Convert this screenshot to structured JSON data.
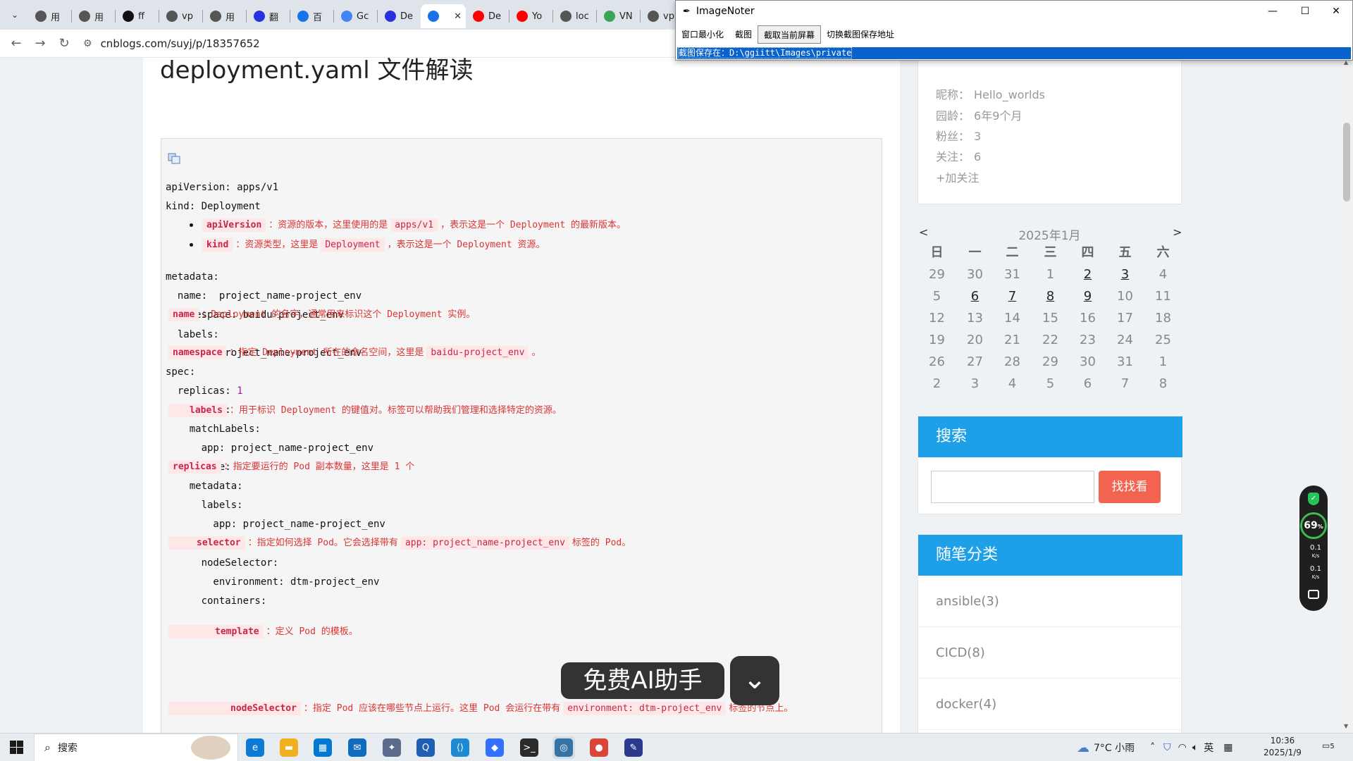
{
  "browser": {
    "tabs": [
      {
        "label": "用",
        "icon": "globe",
        "color": "#555"
      },
      {
        "label": "用",
        "icon": "globe",
        "color": "#555"
      },
      {
        "label": "ff",
        "icon": "github",
        "color": "#111"
      },
      {
        "label": "vp",
        "icon": "globe",
        "color": "#555"
      },
      {
        "label": "用",
        "icon": "globe",
        "color": "#555"
      },
      {
        "label": "翻",
        "icon": "baidu-paw",
        "color": "#2932e1"
      },
      {
        "label": "百",
        "icon": "translate",
        "color": "#1a73e8"
      },
      {
        "label": "Gc",
        "icon": "google-g",
        "color": "#4285f4"
      },
      {
        "label": "De",
        "icon": "baidu-paw",
        "color": "#2932e1"
      },
      {
        "label": "",
        "icon": "cnblogs",
        "color": "#1a73e8",
        "active": true
      },
      {
        "label": "De",
        "icon": "youtube",
        "color": "#ff0000"
      },
      {
        "label": "Yo",
        "icon": "youtube",
        "color": "#ff0000"
      },
      {
        "label": "loc",
        "icon": "globe",
        "color": "#555"
      },
      {
        "label": "VN",
        "icon": "vmware",
        "color": "#3aa655"
      },
      {
        "label": "vp",
        "icon": "globe",
        "color": "#555"
      }
    ],
    "active_tab_close": "✕",
    "url": "cnblogs.com/suyj/p/18357652"
  },
  "article": {
    "title": "deployment.yaml 文件解读",
    "code_lines": [
      "apiVersion: apps/v1",
      "kind: Deployment",
      "metadata:",
      "  name:  project_name-project_env",
      "  namespace: baidu-project_env",
      "  labels:",
      "    app: project_name-project_env",
      "spec:",
      "  replicas: 1",
      "  selector:",
      "    matchLabels:",
      "      app: project_name-project_env",
      "  template:",
      "    metadata:",
      "      labels:",
      "        app: project_name-project_env",
      "    spec:",
      "      nodeSelector:",
      "        environment: dtm-project_env",
      "      containers:"
    ],
    "notes": {
      "apiVersion": {
        "kw": "apiVersion",
        "t1": "：资源的版本，这里使用的是",
        "lit": "apps/v1",
        "t2": "，表示这是一个 Deployment 的最新版本。"
      },
      "kind": {
        "kw": "kind",
        "t1": "：资源类型，这里是",
        "lit": "Deployment",
        "t2": "，表示这是一个 Deployment 资源。"
      },
      "name": {
        "kw": "name",
        "t1": "：Deployment 的名字，通常用来标识这个 Deployment 实例。"
      },
      "namespace": {
        "kw": "namespace",
        "t1": "：指定 Deployment 所在的命名空间，这里是",
        "lit": "baidu-project_env",
        "t2": "。"
      },
      "labels": {
        "kw": "labels",
        "t1": "：用于标识 Deployment 的键值对。标签可以帮助我们管理和选择特定的资源。"
      },
      "replicas": {
        "kw": "replicas",
        "t1": "：指定要运行的 Pod 副本数量，这里是 1 个"
      },
      "selector": {
        "kw": "selector",
        "t1": "：指定如何选择 Pod。它会选择带有",
        "lit": "app: project_name-project_env",
        "t2": "标签的 Pod。"
      },
      "template": {
        "kw": "template",
        "t1": "：定义 Pod 的模板。"
      },
      "nodeSelector": {
        "kw": "nodeSelector",
        "t1": "：指定 Pod 应该在哪些节点上运行。这里 Pod 会运行在带有",
        "lit": "environment: dtm-project_env",
        "t2": "标签的节点上。"
      }
    }
  },
  "sidebar": {
    "profile": {
      "nickname_label": "昵称：",
      "nickname": "Hello_worlds",
      "age_label": "园龄：",
      "age": "6年9个月",
      "fans_label": "粉丝：",
      "fans": "3",
      "follow_label": "关注：",
      "follow": "6",
      "add_follow": "+加关注"
    },
    "calendar": {
      "title": "2025年1月",
      "prev": "<",
      "next": ">",
      "weekdays": [
        "日",
        "一",
        "二",
        "三",
        "四",
        "五",
        "六"
      ],
      "weeks": [
        [
          "29",
          "30",
          "31",
          "1",
          "2",
          "3",
          "4"
        ],
        [
          "5",
          "6",
          "7",
          "8",
          "9",
          "10",
          "11"
        ],
        [
          "12",
          "13",
          "14",
          "15",
          "16",
          "17",
          "18"
        ],
        [
          "19",
          "20",
          "21",
          "22",
          "23",
          "24",
          "25"
        ],
        [
          "26",
          "27",
          "28",
          "29",
          "30",
          "31",
          "1"
        ],
        [
          "2",
          "3",
          "4",
          "5",
          "6",
          "7",
          "8"
        ]
      ],
      "linked_days": [
        "2",
        "3",
        "6",
        "7",
        "8",
        "9"
      ]
    },
    "search": {
      "title": "搜索",
      "button": "找找看",
      "placeholder": ""
    },
    "categories": {
      "title": "随笔分类",
      "items": [
        "ansible(3)",
        "CICD(8)",
        "docker(4)"
      ]
    }
  },
  "monitor": {
    "percent": "69",
    "percent_unit": "%",
    "up": "0.1",
    "down": "0.1",
    "unit": "K/s"
  },
  "imagenoter": {
    "title": "ImageNoter",
    "menu": [
      "窗口最小化",
      "截图",
      "截取当前屏幕",
      "切换截图保存地址"
    ],
    "selected_menu": "截取当前屏幕",
    "status": "截图保存在：D:\\ggiitt\\Images\\private",
    "controls": {
      "min": "—",
      "max": "☐",
      "close": "✕"
    }
  },
  "ai_assistant": {
    "label": "免费AI助手",
    "collapse": "⌄"
  },
  "taskbar": {
    "search_label": "搜索",
    "weather": "7°C 小雨",
    "ime": "英",
    "time": "10:36",
    "date": "2025/1/9",
    "notifications": "5",
    "apps": [
      {
        "name": "edge",
        "color": "#0c7bd6",
        "glyph": "e"
      },
      {
        "name": "file-explorer",
        "color": "#f2b01e",
        "glyph": "▬"
      },
      {
        "name": "store",
        "color": "#0078d4",
        "glyph": "▦"
      },
      {
        "name": "mail",
        "color": "#0f6cbd",
        "glyph": "✉"
      },
      {
        "name": "app-puzzle",
        "color": "#5a6b8c",
        "glyph": "✦"
      },
      {
        "name": "search-app",
        "color": "#1e5fb3",
        "glyph": "Q"
      },
      {
        "name": "vscode",
        "color": "#1f8ad2",
        "glyph": "⟨⟩"
      },
      {
        "name": "feishu",
        "color": "#3370ff",
        "glyph": "◆"
      },
      {
        "name": "terminal",
        "color": "#2b2b2b",
        "glyph": ">_"
      },
      {
        "name": "python-app",
        "color": "#3673a5",
        "glyph": "◎"
      },
      {
        "name": "chrome",
        "color": "#db4437",
        "glyph": "●"
      },
      {
        "name": "imagenoter",
        "color": "#2b3a8c",
        "glyph": "✎"
      }
    ]
  }
}
